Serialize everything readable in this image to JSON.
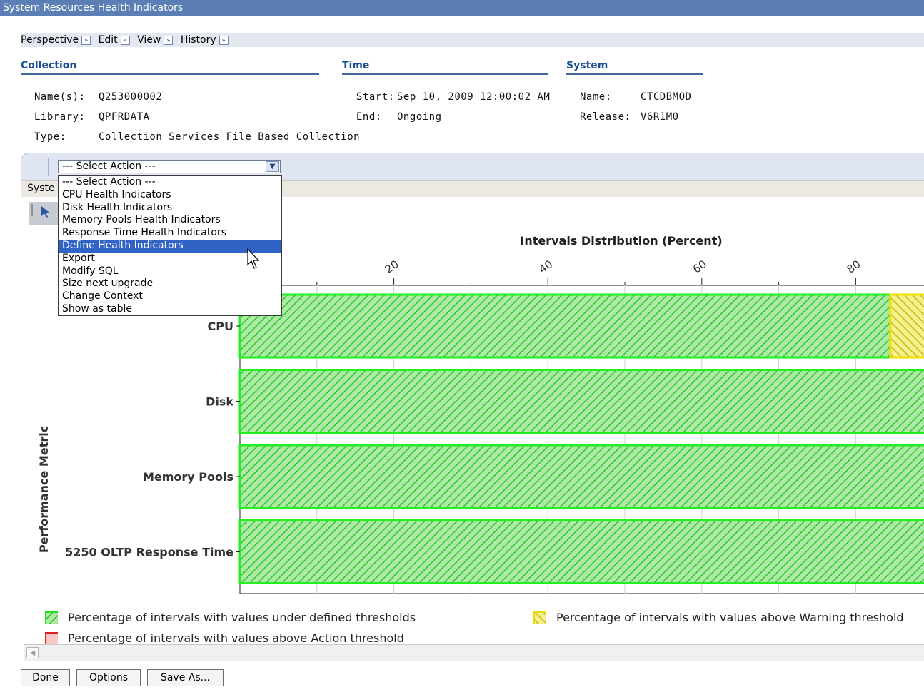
{
  "window": {
    "title": "System Resources Health Indicators"
  },
  "menu": [
    {
      "label": "Perspective"
    },
    {
      "label": "Edit"
    },
    {
      "label": "View"
    },
    {
      "label": "History"
    }
  ],
  "collection": {
    "heading": "Collection",
    "names_label": "Name(s):",
    "names_value": "Q253000002",
    "library_label": "Library:",
    "library_value": "QPFRDATA",
    "type_label": "Type:",
    "type_value": "Collection Services File Based Collection"
  },
  "time": {
    "heading": "Time",
    "start_label": "Start:",
    "start_value": "Sep 10, 2009 12:00:02 AM",
    "end_label": "End:",
    "end_value": "Ongoing"
  },
  "system": {
    "heading": "System",
    "name_label": "Name:",
    "name_value": "CTCDBMOD",
    "release_label": "Release:",
    "release_value": "V6R1M0"
  },
  "action_select": {
    "selected": "--- Select Action ---",
    "options": [
      "--- Select Action ---",
      "CPU Health Indicators",
      "Disk Health Indicators",
      "Memory Pools Health Indicators",
      "Response Time Health Indicators",
      "Define Health Indicators",
      "Export",
      "Modify SQL",
      "Size next upgrade",
      "Change Context",
      "Show as table"
    ],
    "highlighted": "Define Health Indicators"
  },
  "tab": {
    "label": "Syste"
  },
  "chart_data": {
    "type": "bar",
    "orientation": "horizontal",
    "stacked": true,
    "title": "Intervals Distribution (Percent)",
    "ylabel": "Performance Metric",
    "categories": [
      "CPU",
      "Disk",
      "Memory Pools",
      "5250 OLTP Response Time"
    ],
    "xticks": [
      "20",
      "40",
      "60",
      "80"
    ],
    "x_range_visible": [
      0,
      88
    ],
    "series": [
      {
        "name": "Percentage of intervals with values under defined thresholds",
        "color": "#44ee44",
        "values": [
          84.5,
          100,
          100,
          100
        ]
      },
      {
        "name": "Percentage of intervals with values above Warning threshold",
        "color": "#f0e000",
        "values": [
          15.5,
          0,
          0,
          0
        ]
      },
      {
        "name": "Percentage of intervals with values above Action threshold",
        "color": "#ee2222",
        "values": [
          0,
          0,
          0,
          0
        ]
      }
    ],
    "grid": true,
    "legend_position": "bottom"
  },
  "buttons": {
    "done": "Done",
    "options": "Options",
    "save_as": "Save As..."
  },
  "colors": {
    "title_bg": "#5b7fb4",
    "heading": "#1a4f97",
    "selection": "#3163c6"
  }
}
